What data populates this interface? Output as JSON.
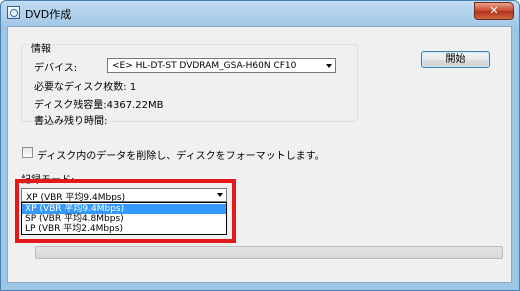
{
  "window": {
    "title": "DVD作成",
    "close_glyph": "✕"
  },
  "info": {
    "group_title": "情報",
    "device_label": "デバイス:",
    "device_value": "<E> HL-DT-ST DVDRAM_GSA-H60N CF10",
    "required_discs": "必要なディスク枚数: 1",
    "remaining_capacity": "ディスク残容量:4367.22MB",
    "remaining_time": "書込み残り時間:"
  },
  "start_button": "開始",
  "erase_option": {
    "label": "ディスク内のデータを削除し、ディスクをフォーマットします。",
    "checked": false
  },
  "record_mode": {
    "label": "記録モード:",
    "selected": "XP (VBR 平均9.4Mbps)",
    "options": [
      "XP (VBR 平均9.4Mbps)",
      "SP (VBR 平均4.8Mbps)",
      "LP (VBR 平均2.4Mbps)"
    ],
    "selected_index": 0
  },
  "progress": {
    "value": 0
  },
  "colors": {
    "highlight": "#e5191b",
    "selection": "#3399ff",
    "title_bar": "#a9cde9",
    "close_button": "#c7452a"
  }
}
